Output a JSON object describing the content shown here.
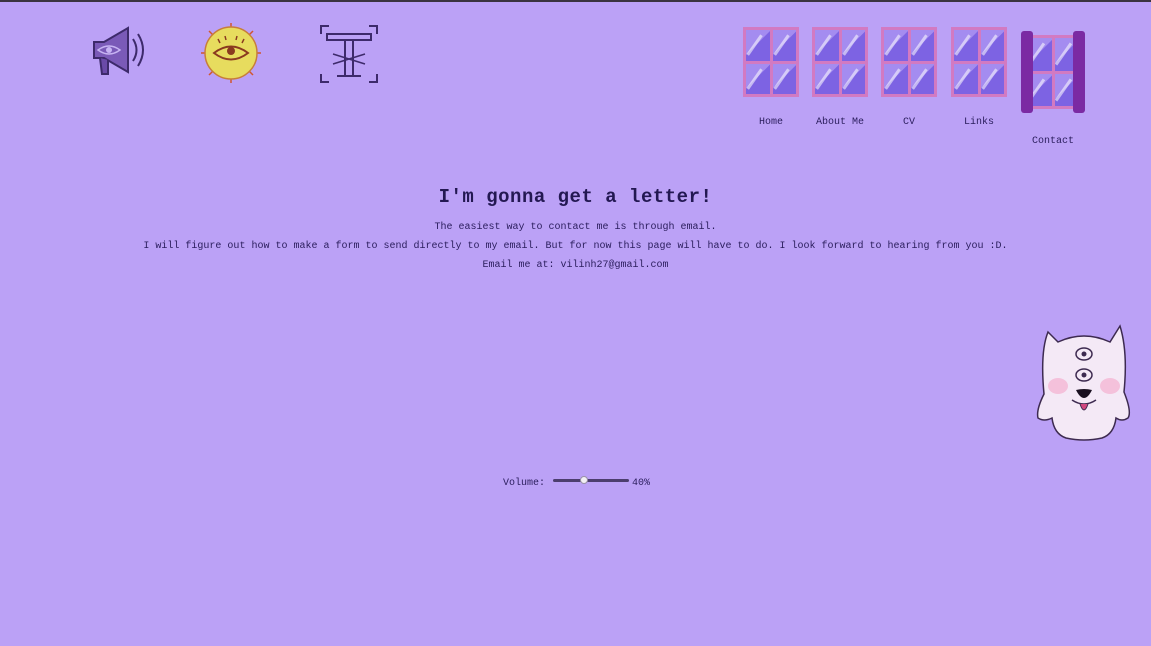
{
  "top_icons": {
    "sound": "megaphone-eye-icon",
    "theme": "sun-eye-icon",
    "font": "type-t-icon"
  },
  "nav": {
    "items": [
      {
        "label": "Home",
        "icon": "window-icon"
      },
      {
        "label": "About Me",
        "icon": "window-icon"
      },
      {
        "label": "CV",
        "icon": "window-icon"
      },
      {
        "label": "Links",
        "icon": "window-icon"
      },
      {
        "label": "Contact",
        "icon": "open-window-curtains-icon",
        "active": true
      }
    ]
  },
  "main": {
    "heading": "I'm gonna get a letter!",
    "line1": "The easiest way to contact me is through email.",
    "line2": "I will figure out how to make a form to send directly to my email. But for now this page will have to do. I look forward to hearing from you :D.",
    "line3": "Email me at: vilinh27@gmail.com"
  },
  "volume": {
    "label": "Volume:",
    "value": 40,
    "value_text": "40%"
  },
  "mascot": "three-eyed-creature-icon",
  "colors": {
    "background": "#bba1f6",
    "text": "#2a1d5c",
    "window_frame": "#d27ac2",
    "curtain": "#7b2aa3",
    "sun": "#e7dc5e"
  }
}
